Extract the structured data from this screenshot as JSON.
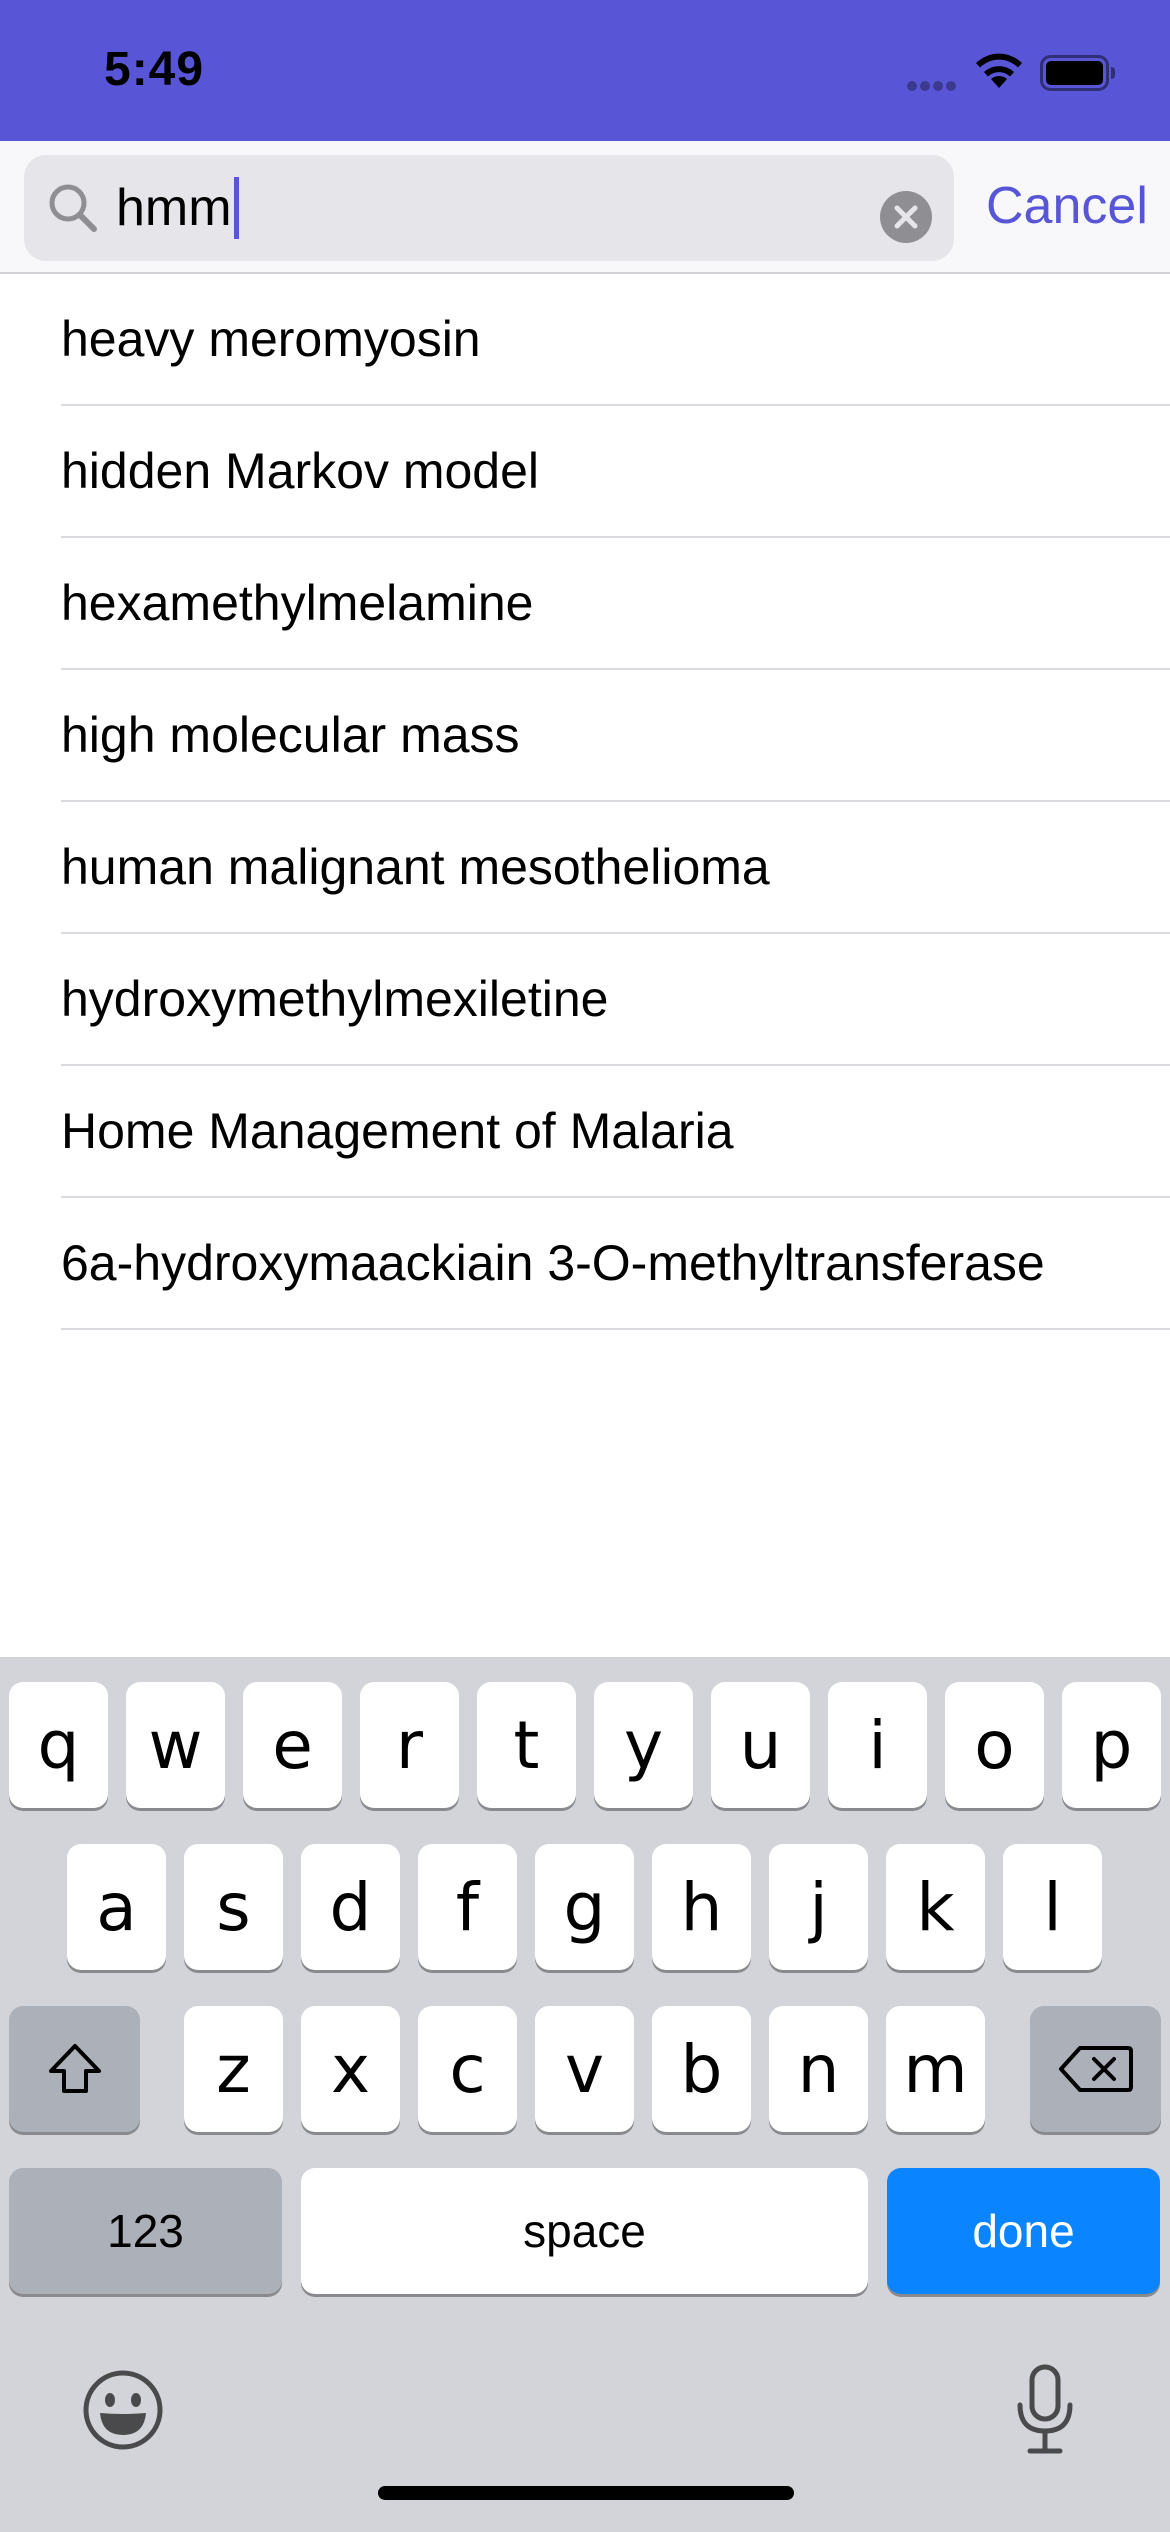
{
  "status_bar": {
    "time": "5:49",
    "background_color": "#5856D6"
  },
  "search": {
    "value": "hmm",
    "cancel_label": "Cancel",
    "accent_color": "#5856D6",
    "icons": [
      "search-icon",
      "clear-icon"
    ]
  },
  "results": [
    {
      "label": "heavy meromyosin"
    },
    {
      "label": "hidden Markov model"
    },
    {
      "label": "hexamethylmelamine"
    },
    {
      "label": "high molecular mass"
    },
    {
      "label": "human malignant mesothelioma"
    },
    {
      "label": "hydroxymethylmexiletine"
    },
    {
      "label": "Home Management of Malaria"
    },
    {
      "label": "6a-hydroxymaackiain 3-O-methyltransferase"
    }
  ],
  "keyboard": {
    "row1": [
      "q",
      "w",
      "e",
      "r",
      "t",
      "y",
      "u",
      "i",
      "o",
      "p"
    ],
    "row2": [
      "a",
      "s",
      "d",
      "f",
      "g",
      "h",
      "j",
      "k",
      "l"
    ],
    "row3": [
      "z",
      "x",
      "c",
      "v",
      "b",
      "n",
      "m"
    ],
    "numbers_label": "123",
    "space_label": "space",
    "return_label": "done",
    "return_color": "#0A84FF",
    "icons": [
      "shift-icon",
      "backspace-icon",
      "emoji-icon",
      "microphone-icon"
    ]
  }
}
